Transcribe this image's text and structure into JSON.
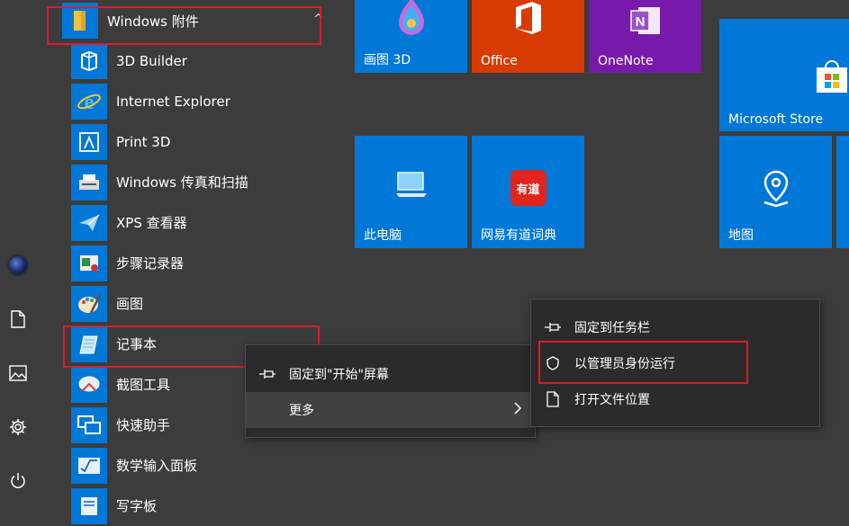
{
  "group": {
    "name": "Windows 附件",
    "chevron": "^"
  },
  "apps": [
    {
      "label": "3D Builder",
      "icon": "3d-builder-icon"
    },
    {
      "label": "Internet Explorer",
      "icon": "internet-explorer-icon"
    },
    {
      "label": "Print 3D",
      "icon": "print-3d-icon"
    },
    {
      "label": "Windows 传真和扫描",
      "icon": "fax-scan-icon"
    },
    {
      "label": "XPS 查看器",
      "icon": "xps-viewer-icon"
    },
    {
      "label": "步骤记录器",
      "icon": "steps-recorder-icon"
    },
    {
      "label": "画图",
      "icon": "paint-icon"
    },
    {
      "label": "记事本",
      "icon": "notepad-icon"
    },
    {
      "label": "截图工具",
      "icon": "snipping-tool-icon"
    },
    {
      "label": "快速助手",
      "icon": "quick-assist-icon"
    },
    {
      "label": "数学输入面板",
      "icon": "math-input-icon"
    },
    {
      "label": "写字板",
      "icon": "wordpad-icon"
    }
  ],
  "tiles": {
    "paint3d": "画图 3D",
    "office": "Office",
    "onenote": "OneNote",
    "store": "Microsoft Store",
    "thispc": "此电脑",
    "youdao": "网易有道词典",
    "maps": "地图",
    "youdao_logo": "有道"
  },
  "context_menu_1": {
    "pin_start": "固定到\"开始\"屏幕",
    "more": "更多"
  },
  "context_menu_2": {
    "pin_taskbar": "固定到任务栏",
    "run_admin": "以管理员身份运行",
    "open_location": "打开文件位置"
  },
  "colors": {
    "accent": "#0078d7",
    "office": "#d83b01",
    "onenote": "#7719aa",
    "highlight_box": "#e0192c"
  }
}
